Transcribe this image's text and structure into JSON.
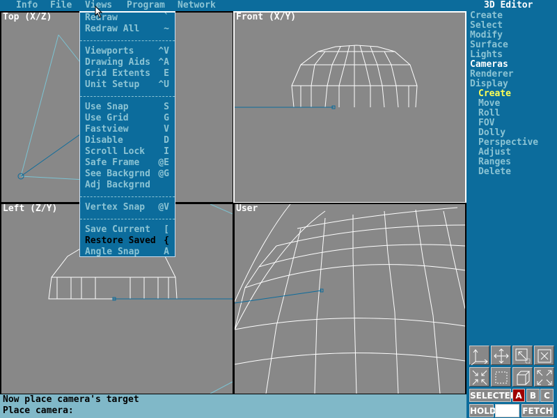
{
  "menubar": {
    "items": [
      "Info",
      "File",
      "Views",
      "Program",
      "Network"
    ]
  },
  "views_menu": {
    "groups": [
      [
        {
          "label": "Redraw",
          "key": "`"
        },
        {
          "label": "Redraw All",
          "key": "~"
        }
      ],
      [
        {
          "label": "Viewports",
          "key": "^V"
        },
        {
          "label": "Drawing Aids",
          "key": "^A"
        },
        {
          "label": "Grid Extents",
          "key": "E"
        },
        {
          "label": "Unit Setup",
          "key": "^U"
        }
      ],
      [
        {
          "label": "Use Snap",
          "key": "S"
        },
        {
          "label": "Use Grid",
          "key": "G"
        },
        {
          "label": "Fastview",
          "key": "V"
        },
        {
          "label": "Disable",
          "key": "D"
        },
        {
          "label": "Scroll Lock",
          "key": "I"
        },
        {
          "label": "Safe Frame",
          "key": "@E"
        },
        {
          "label": "See Backgrnd",
          "key": "@G"
        },
        {
          "label": "Adj Backgrnd",
          "key": ""
        }
      ],
      [
        {
          "label": "Vertex Snap",
          "key": "@V"
        }
      ],
      [
        {
          "label": "Save Current",
          "key": "["
        },
        {
          "label": "Restore Saved",
          "key": "{"
        },
        {
          "label": "Angle Snap",
          "key": "A"
        }
      ]
    ],
    "highlighted": "Restore Saved"
  },
  "viewports": {
    "top": "Top (X/Z)",
    "front": "Front (X/Y)",
    "left": "Left (Z/Y)",
    "user": "User"
  },
  "side": {
    "title": "3D Editor",
    "items": [
      "Create",
      "Select",
      "Modify",
      "Surface",
      "Lights",
      "Cameras",
      "Renderer",
      "Display"
    ],
    "active": "Cameras",
    "subitems": [
      "Create",
      "Move",
      "Roll",
      "FOV",
      "Dolly",
      "Perspective",
      "Adjust",
      "Ranges",
      "Delete"
    ],
    "active_sub": "Create"
  },
  "toolbox": {
    "icons": [
      "axis-icon",
      "pan-icon",
      "zoom-window-icon",
      "zoom-extents-icon",
      "zoom-in-icon",
      "region-icon",
      "cube-icon",
      "zoom-out-icon"
    ],
    "selected": "SELECTED",
    "a": "A",
    "b": "B",
    "c": "C",
    "hold": "HOLD",
    "fetch": "FETCH",
    "active_selection": "A"
  },
  "status": {
    "line1": "Now place camera's target",
    "line2": "Place camera:"
  },
  "colors": {
    "bg": "#0c6c9c",
    "viewport": "#888888",
    "menu_text": "#8cc4d4",
    "active": "#ffff55",
    "sel": "#a00000"
  }
}
